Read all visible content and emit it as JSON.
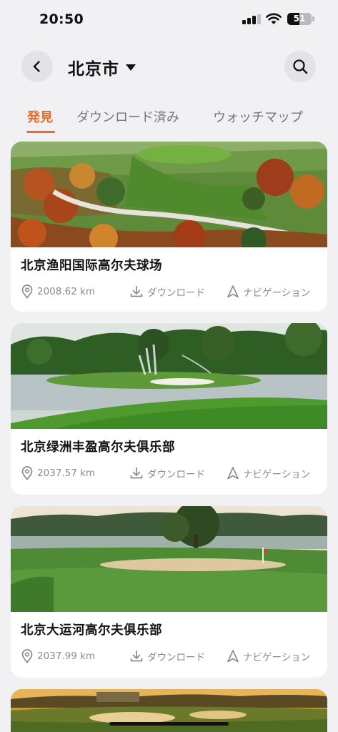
{
  "status_bar": {
    "time": "20:50",
    "battery": "51",
    "battery_level": 0.51
  },
  "header": {
    "city": "北京市",
    "back_icon": "chevron-left-icon",
    "search_icon": "search-icon",
    "dropdown_icon": "caret-down-icon"
  },
  "tabs": [
    {
      "label": "発見",
      "active": true
    },
    {
      "label": "ダウンロード済み",
      "active": false
    },
    {
      "label": "ウォッチマップ",
      "active": false
    }
  ],
  "courses": [
    {
      "name": "北京渔阳国际高尔夫球场",
      "distance": "2008.62 km",
      "download_label": "ダウンロード",
      "navigation_label": "ナビゲーション"
    },
    {
      "name": "北京绿洲丰盈高尔夫俱乐部",
      "distance": "2037.57 km",
      "download_label": "ダウンロード",
      "navigation_label": "ナビゲーション"
    },
    {
      "name": "北京大运河高尔夫俱乐部",
      "distance": "2037.99 km",
      "download_label": "ダウンロード",
      "navigation_label": "ナビゲーション"
    }
  ],
  "colors": {
    "accent": "#ee6a2b",
    "background": "#f1f1f4",
    "card": "#ffffff",
    "meta_text": "#8a8a8f"
  }
}
